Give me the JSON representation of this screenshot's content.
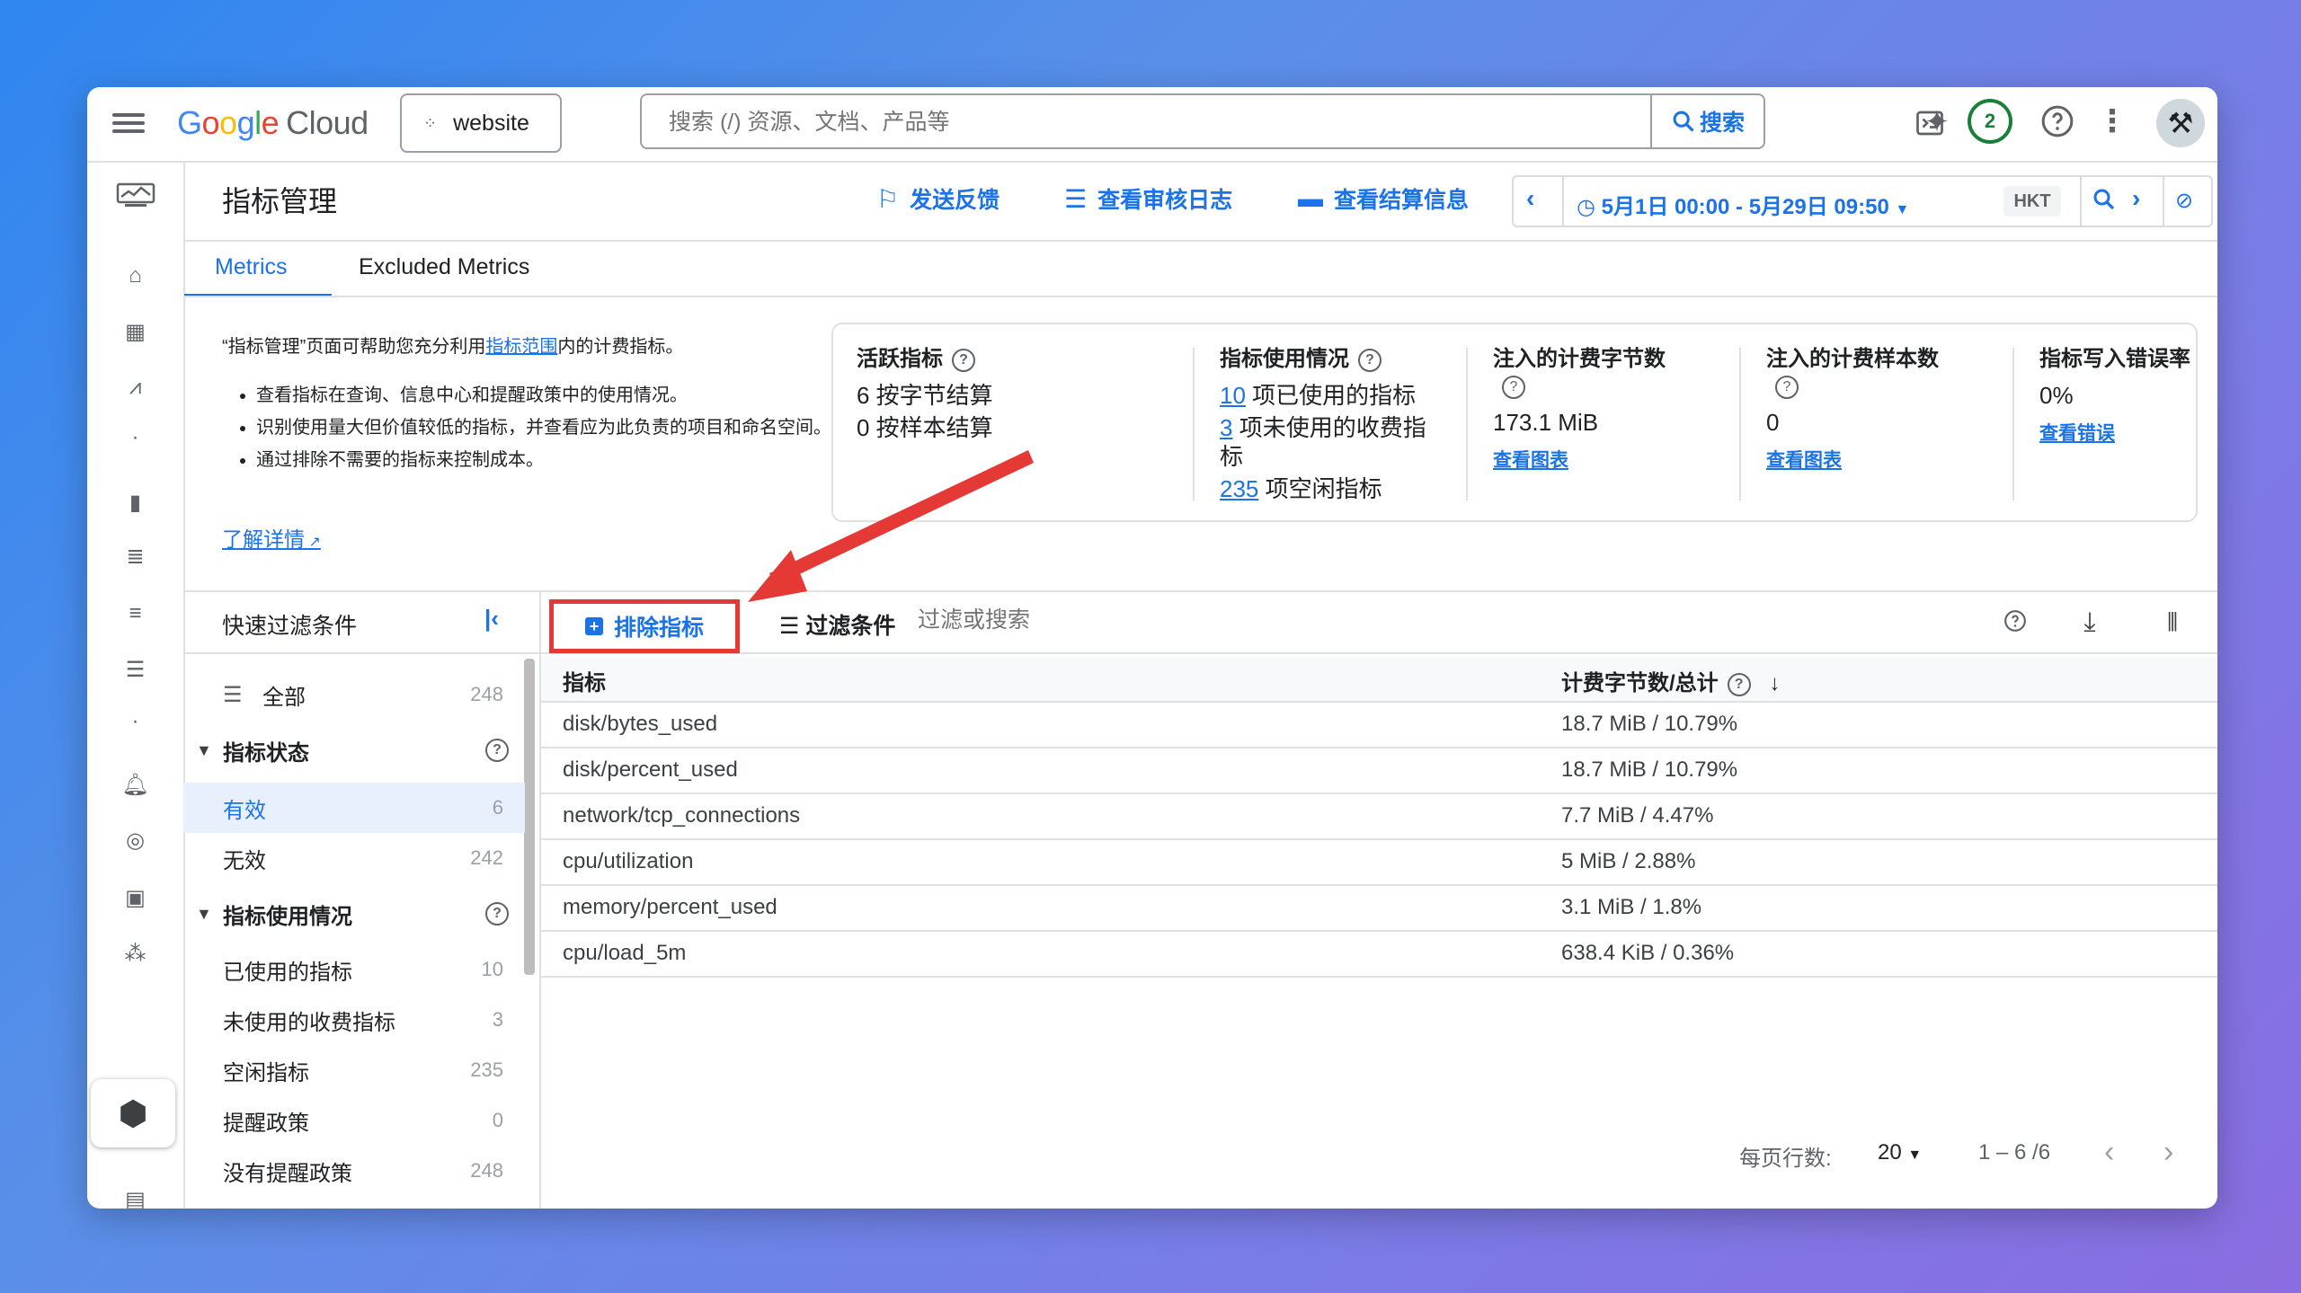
{
  "topbar": {
    "logo_google": [
      "G",
      "o",
      "o",
      "g",
      "l",
      "e"
    ],
    "logo_cloud": "Cloud",
    "project": "website",
    "search_placeholder": "搜索 (/) 资源、文档、产品等",
    "search_button": "搜索",
    "notifications_count": "2"
  },
  "page": {
    "title": "指标管理",
    "feedback": "发送反馈",
    "audit_log": "查看审核日志",
    "billing": "查看结算信息",
    "date_range": "5月1日 00:00 - 5月29日 09:50",
    "timezone": "HKT"
  },
  "tabs": [
    {
      "label": "Metrics",
      "active": true
    },
    {
      "label": "Excluded Metrics",
      "active": false
    }
  ],
  "info": {
    "intro_pre": "“指标管理”页面可帮助您充分利用",
    "intro_link": "指标范围",
    "intro_post": "内的计费指标。",
    "bullets": [
      "查看指标在查询、信息中心和提醒政策中的使用情况。",
      "识别使用量大但价值较低的指标，并查看应为此负责的项目和命名空间。",
      "通过排除不需要的指标来控制成本。"
    ],
    "learn_more": "了解详情"
  },
  "stats": {
    "active": {
      "title": "活跃指标",
      "line1": "6 按字节结算",
      "line2": "0 按样本结算"
    },
    "usage": {
      "title": "指标使用情况",
      "used_count": "10",
      "used_text": "项已使用的指标",
      "unused_count": "3",
      "unused_text": "项未使用的收费指标",
      "idle_count": "235",
      "idle_text": "项空闲指标"
    },
    "bytes": {
      "title": "注入的计费字节数",
      "value": "173.1 MiB",
      "link": "查看图表"
    },
    "samples": {
      "title": "注入的计费样本数",
      "value": "0",
      "link": "查看图表"
    },
    "errors": {
      "title": "指标写入错误率",
      "value": "0%",
      "link": "查看错误"
    }
  },
  "quick_filter": {
    "title": "快速过滤条件",
    "all": {
      "label": "全部",
      "count": "248"
    },
    "status_group": "指标状态",
    "status": [
      {
        "label": "有效",
        "count": "6",
        "selected": true
      },
      {
        "label": "无效",
        "count": "242",
        "selected": false
      }
    ],
    "usage_group": "指标使用情况",
    "usage": [
      {
        "label": "已使用的指标",
        "count": "10"
      },
      {
        "label": "未使用的收费指标",
        "count": "3"
      },
      {
        "label": "空闲指标",
        "count": "235"
      },
      {
        "label": "提醒政策",
        "count": "0"
      },
      {
        "label": "没有提醒政策",
        "count": "248"
      }
    ]
  },
  "toolbar": {
    "exclude": "排除指标",
    "filter": "过滤条件",
    "filter_placeholder": "过滤或搜索"
  },
  "table": {
    "col_metric": "指标",
    "col_bytes": "计费字节数/总计",
    "rows": [
      {
        "metric": "disk/bytes_used",
        "bytes": "18.7 MiB / 10.79%"
      },
      {
        "metric": "disk/percent_used",
        "bytes": "18.7 MiB / 10.79%"
      },
      {
        "metric": "network/tcp_connections",
        "bytes": "7.7 MiB / 4.47%"
      },
      {
        "metric": "cpu/utilization",
        "bytes": "5 MiB / 2.88%"
      },
      {
        "metric": "memory/percent_used",
        "bytes": "3.1 MiB / 1.8%"
      },
      {
        "metric": "cpu/load_5m",
        "bytes": "638.4 KiB / 0.36%"
      }
    ]
  },
  "pagination": {
    "rows_per_page_label": "每页行数:",
    "rows_per_page": "20",
    "range": "1 – 6 /6"
  },
  "colors": {
    "accent": "#1a73e8",
    "highlight": "#e53935",
    "success": "#188038"
  }
}
